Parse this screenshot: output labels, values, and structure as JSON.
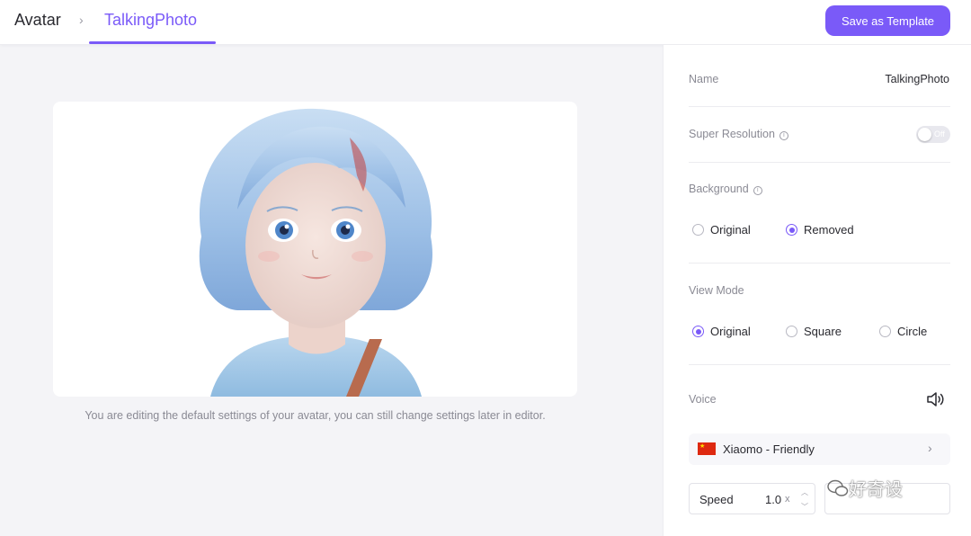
{
  "header": {
    "breadcrumb_root": "Avatar",
    "breadcrumb_sep": "›",
    "breadcrumb_current": "TalkingPhoto",
    "save_button": "Save as Template"
  },
  "preview": {
    "caption": "You are editing the default settings of your avatar, you can still change settings later in editor."
  },
  "panel": {
    "name_label": "Name",
    "name_value": "TalkingPhoto",
    "super_res_label": "Super Resolution",
    "super_res_toggle": "Off",
    "background_label": "Background",
    "background_options": [
      "Original",
      "Removed"
    ],
    "background_selected": "Removed",
    "view_mode_label": "View Mode",
    "view_mode_options": [
      "Original",
      "Square",
      "Circle"
    ],
    "view_mode_selected": "Original",
    "voice_label": "Voice",
    "voice_name": "Xiaomo - Friendly",
    "speed_label": "Speed",
    "speed_value": "1.0",
    "speed_unit": "x"
  },
  "watermark": "好奇设",
  "colors": {
    "accent": "#7a5af8",
    "flag_red": "#de2910",
    "flag_star": "#ffde00"
  },
  "icons": {
    "breadcrumb_separator": "chevron-right-icon",
    "info": "info-icon",
    "speaker": "speaker-icon",
    "voice_chevron": "chevron-right-icon",
    "spin_up": "chevron-up-icon",
    "spin_down": "chevron-down-icon"
  }
}
